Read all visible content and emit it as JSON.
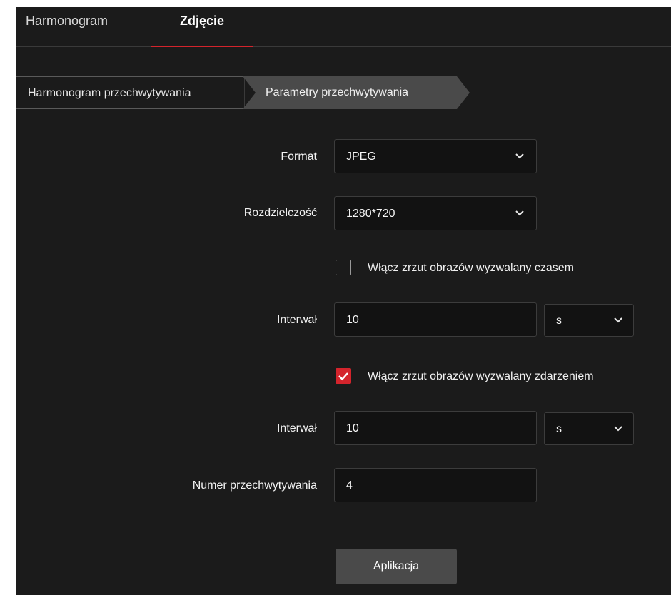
{
  "tabs": {
    "schedule": "Harmonogram",
    "snapshot": "Zdjęcie"
  },
  "steps": {
    "step1": "Harmonogram przechwytywania",
    "step2": "Parametry przechwytywania"
  },
  "form": {
    "format_label": "Format",
    "format_value": "JPEG",
    "resolution_label": "Rozdzielczość",
    "resolution_value": "1280*720",
    "timed_checkbox_label": "Włącz zrzut obrazów wyzwalany czasem",
    "timed_checked": false,
    "timed_interval_label": "Interwał",
    "timed_interval_value": "10",
    "timed_unit": "s",
    "event_checkbox_label": "Włącz zrzut obrazów wyzwalany zdarzeniem",
    "event_checked": true,
    "event_interval_label": "Interwał",
    "event_interval_value": "10",
    "event_unit": "s",
    "capture_number_label": "Numer przechwytywania",
    "capture_number_value": "4"
  },
  "apply_label": "Aplikacja",
  "colors": {
    "accent": "#d4242c",
    "panel_bg": "#1b1b1b",
    "field_bg": "#121212",
    "button_bg": "#4a4a4a"
  },
  "icons": {
    "dropdown": "chevron-down-icon",
    "check": "checkmark-icon"
  }
}
